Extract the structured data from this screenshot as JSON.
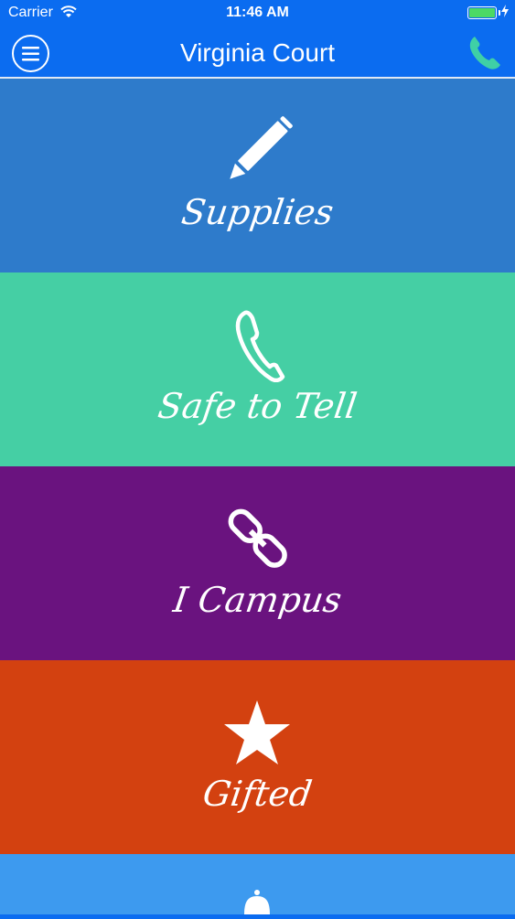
{
  "status_bar": {
    "carrier": "Carrier",
    "time": "11:46 AM"
  },
  "header": {
    "title": "Virginia Court"
  },
  "tiles": [
    {
      "label": "Supplies",
      "icon": "pencil-icon",
      "color": "#2e7bcb"
    },
    {
      "label": "Safe to Tell",
      "icon": "phone-icon",
      "color": "#45cfa4"
    },
    {
      "label": "I Campus",
      "icon": "link-icon",
      "color": "#6a137f"
    },
    {
      "label": "Gifted",
      "icon": "star-icon",
      "color": "#d34110"
    },
    {
      "label": "",
      "icon": "bell-icon",
      "color": "#3d9aef"
    }
  ],
  "colors": {
    "nav": "#0b6cf0",
    "phone_accent": "#3fd0a6"
  }
}
